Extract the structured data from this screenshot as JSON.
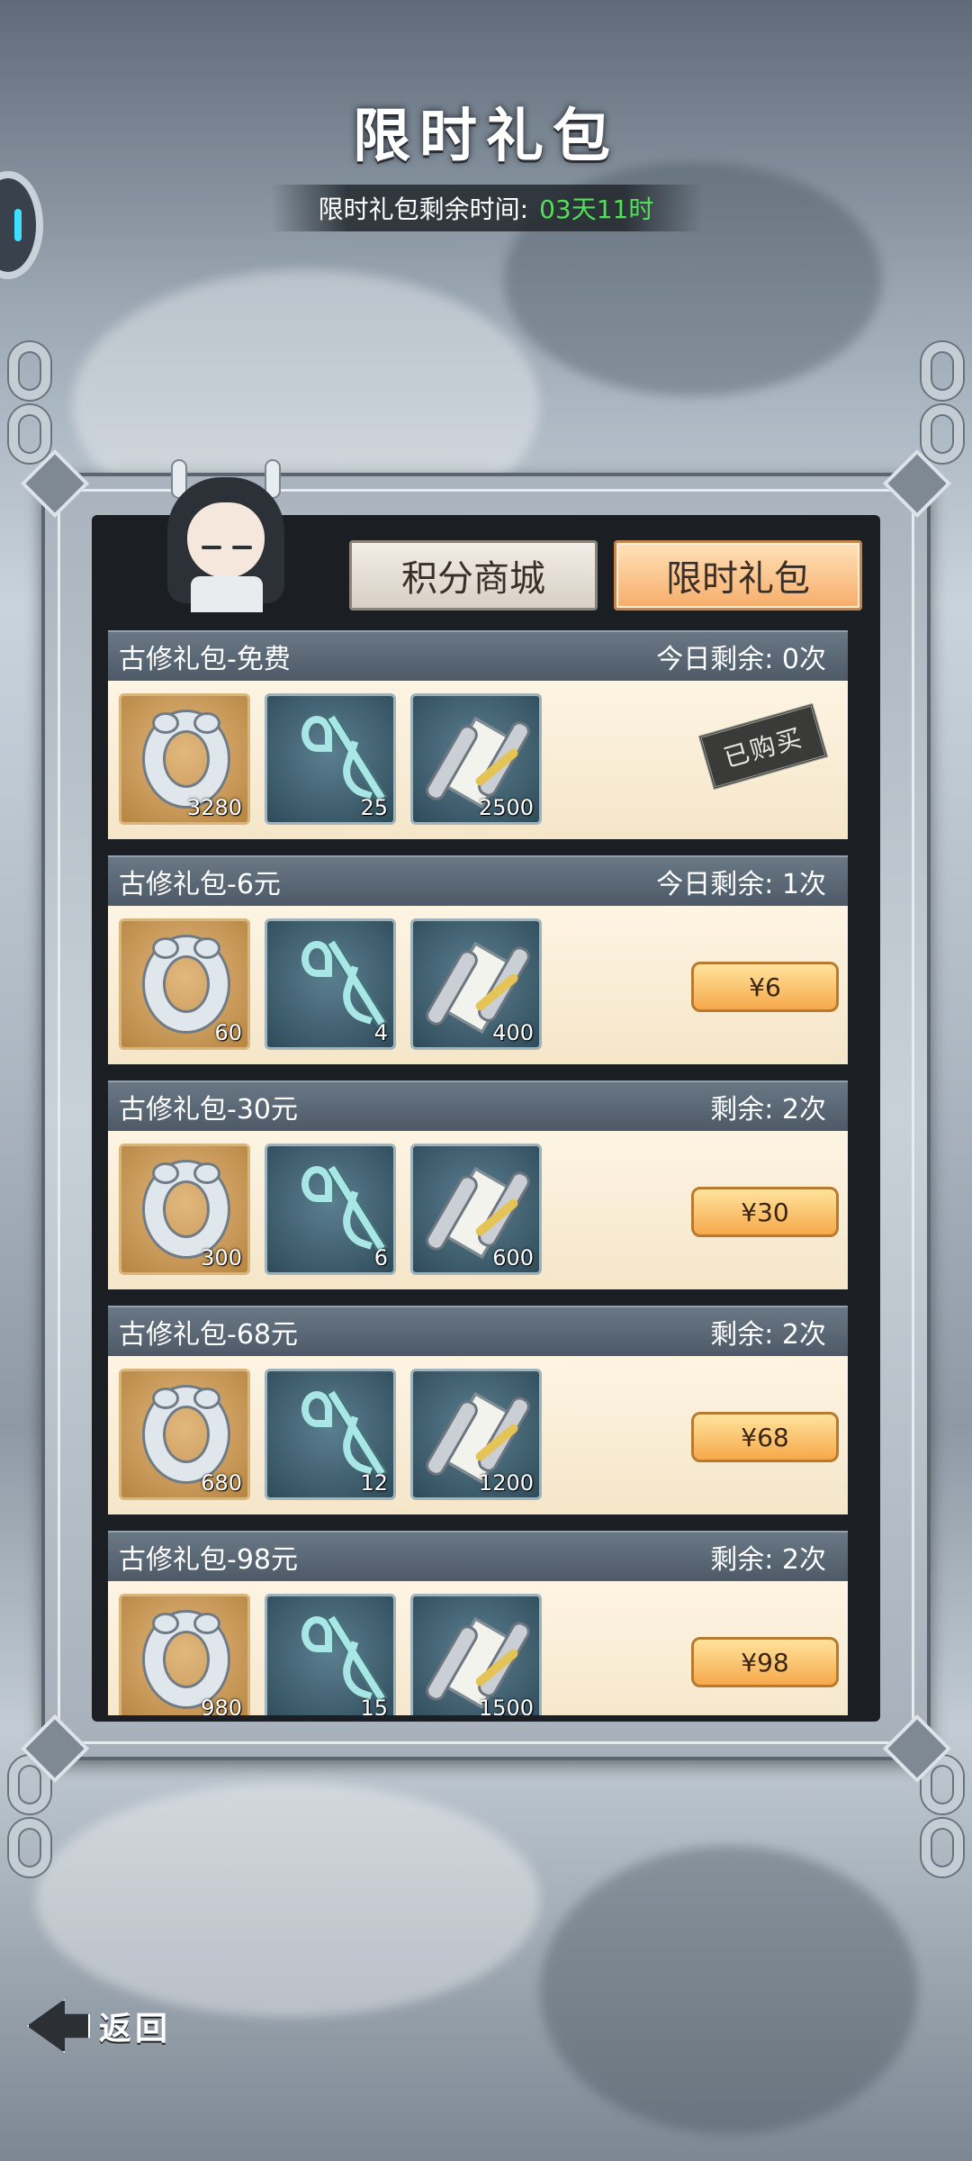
{
  "header": {
    "title": "限时礼包",
    "timer_label": "限时礼包剩余时间:",
    "timer_value": "03天11时"
  },
  "tabs": [
    {
      "label": "积分商城",
      "selected": false
    },
    {
      "label": "限时礼包",
      "selected": true
    }
  ],
  "packs": [
    {
      "name": "古修礼包-免费",
      "remaining": "今日剩余: 0次",
      "items": [
        {
          "icon": "ring-icon",
          "qty": "3280"
        },
        {
          "icon": "whip-icon",
          "qty": "25"
        },
        {
          "icon": "scroll-icon",
          "qty": "2500"
        }
      ],
      "status": "已购买"
    },
    {
      "name": "古修礼包-6元",
      "remaining": "今日剩余: 1次",
      "items": [
        {
          "icon": "ring-icon",
          "qty": "60"
        },
        {
          "icon": "whip-icon",
          "qty": "4"
        },
        {
          "icon": "scroll-icon",
          "qty": "400"
        }
      ],
      "price": "¥6"
    },
    {
      "name": "古修礼包-30元",
      "remaining": "剩余: 2次",
      "items": [
        {
          "icon": "ring-icon",
          "qty": "300"
        },
        {
          "icon": "whip-icon",
          "qty": "6"
        },
        {
          "icon": "scroll-icon",
          "qty": "600"
        }
      ],
      "price": "¥30"
    },
    {
      "name": "古修礼包-68元",
      "remaining": "剩余: 2次",
      "items": [
        {
          "icon": "ring-icon",
          "qty": "680"
        },
        {
          "icon": "whip-icon",
          "qty": "12"
        },
        {
          "icon": "scroll-icon",
          "qty": "1200"
        }
      ],
      "price": "¥68"
    },
    {
      "name": "古修礼包-98元",
      "remaining": "剩余: 2次",
      "items": [
        {
          "icon": "ring-icon",
          "qty": "980"
        },
        {
          "icon": "whip-icon",
          "qty": "15"
        },
        {
          "icon": "scroll-icon",
          "qty": "1500"
        }
      ],
      "price": "¥98"
    }
  ],
  "footer": {
    "back_label": "返回"
  },
  "colors": {
    "timer_green": "#52e05a",
    "selected_tab": "#f6ad6a",
    "buy_button": "#f6a94b"
  }
}
